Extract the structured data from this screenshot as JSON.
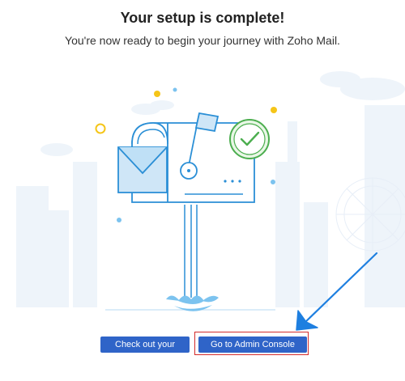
{
  "header": {
    "title": "Your setup is complete!",
    "subtitle": "You're now ready to begin your journey with Zoho Mail."
  },
  "actions": {
    "inbox_label": "Check out your inbox",
    "admin_label": "Go to Admin Console"
  },
  "colors": {
    "button_blue": "#2f64c8",
    "highlight_red": "#d32b2b",
    "arrow_blue": "#1e7fe0",
    "line_blue": "#2b8fd6",
    "check_green": "#4cae4f",
    "accent_yellow": "#f5c518"
  },
  "icons": {
    "illustration": "mailbox-with-envelope-and-checkmark",
    "pointer": "pointing-arrow"
  }
}
